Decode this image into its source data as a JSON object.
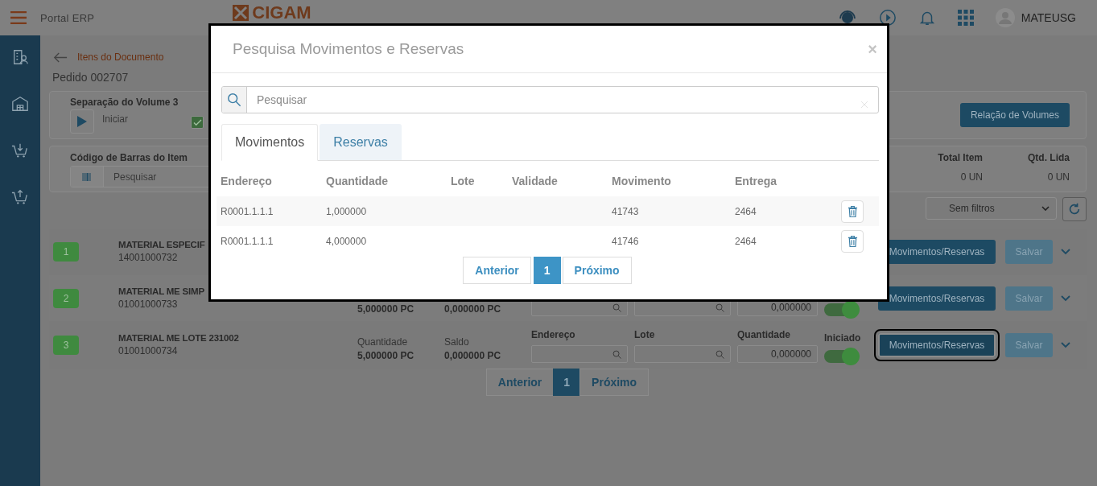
{
  "header": {
    "app_title": "Portal ERP",
    "logo": "CIGAM",
    "user": "MATEUSG"
  },
  "breadcrumb": {
    "title": "Itens do Documento"
  },
  "order_title": "Pedido 002707",
  "volume_card": {
    "title": "Separação do Volume 3",
    "start_label": "Iniciar",
    "checked": true,
    "relation_button": "Relação de Volumes"
  },
  "barcode_card": {
    "label": "Código de Barras do Item",
    "placeholder": "Pesquisar",
    "totals": [
      {
        "label": "Total Item",
        "value": "0 UN"
      },
      {
        "label": "Qtd. Lida",
        "value": "0 UN"
      }
    ]
  },
  "filter": {
    "value": "Sem filtros"
  },
  "items": [
    {
      "number": "1",
      "name": "MATERIAL ESPECIF",
      "code": "14001000732",
      "actions_button": "Movimentos/Reservas",
      "save_button": "Salvar",
      "focused": false
    },
    {
      "number": "2",
      "name": "MATERIAL ME SIMP",
      "code": "01001000733",
      "quantity": "5,000000 PC",
      "balance": "0,000000 PC",
      "fields": [
        {
          "kind": "lookup"
        },
        {
          "kind": "lookup"
        },
        {
          "kind": "number",
          "value": "0,000000"
        }
      ],
      "started": true,
      "actions_button": "Movimentos/Reservas",
      "save_button": "Salvar",
      "focused": false
    },
    {
      "number": "3",
      "name": "MATERIAL ME LOTE 231002",
      "code": "01001000734",
      "quantity_label": "Quantidade",
      "quantity": "5,000000 PC",
      "balance_label": "Saldo",
      "balance": "0,000000 PC",
      "fields": [
        {
          "kind": "lookup",
          "label": "Endereço"
        },
        {
          "kind": "lookup",
          "label": "Lote"
        },
        {
          "kind": "number",
          "label": "Quantidade",
          "value": "0,000000"
        }
      ],
      "status_label": "Iniciado",
      "started": true,
      "actions_button": "Movimentos/Reservas",
      "save_button": "Salvar",
      "focused": true
    }
  ],
  "pagination": {
    "previous": "Anterior",
    "pages": [
      {
        "label": "1",
        "selected": true
      }
    ],
    "next": "Próximo"
  },
  "modal": {
    "title": "Pesquisa Movimentos e Reservas",
    "close": "×",
    "search_placeholder": "Pesquisar",
    "tabs": [
      {
        "label": "Movimentos",
        "selected": true
      },
      {
        "label": "Reservas",
        "selected": false
      }
    ],
    "columns": [
      "Endereço",
      "Quantidade",
      "Lote",
      "Validade",
      "Movimento",
      "Entrega"
    ],
    "rows": [
      {
        "cells": [
          "R0001.1.1.1",
          "1,000000",
          "",
          "",
          "41743",
          "2464"
        ]
      },
      {
        "cells": [
          "R0001.1.1.1",
          "4,000000",
          "",
          "",
          "41746",
          "2464"
        ]
      }
    ],
    "pagination": {
      "previous": "Anterior",
      "pages": [
        {
          "label": "1",
          "selected": true
        }
      ],
      "next": "Próximo"
    }
  }
}
